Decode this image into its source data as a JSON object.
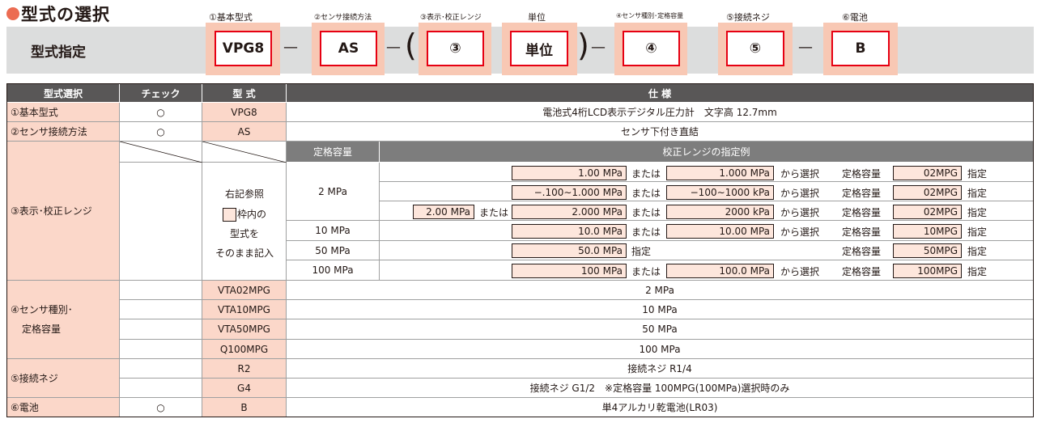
{
  "header": {
    "title": "型式の選択",
    "band_label": "型式指定",
    "slots": [
      {
        "label": "①基本型式",
        "value": "VPG8"
      },
      {
        "label": "②センサ接続方法",
        "value": "AS"
      },
      {
        "label": "③表示･校正レンジ",
        "value": "③"
      },
      {
        "label": "単位",
        "value": "単位"
      },
      {
        "label": "④センサ種別･定格容量",
        "value": "④"
      },
      {
        "label": "⑤接続ネジ",
        "value": "⑤"
      },
      {
        "label": "⑥電池",
        "value": "B"
      }
    ],
    "dash": "—",
    "open_paren": "(",
    "close_paren": ")"
  },
  "table": {
    "headers": {
      "select": "型式選択",
      "check": "チェック",
      "model": "型 式",
      "spec": "仕 様"
    },
    "check_mark": "○",
    "row1": {
      "select": "①基本型式",
      "model": "VPG8",
      "spec": "電池式4桁LCD表示デジタル圧力計　文字高 12.7mm"
    },
    "row2": {
      "select": "②センサ接続方法",
      "model": "AS",
      "spec": "センサ下付き直結"
    },
    "row3": {
      "select": "③表示･校正レンジ",
      "sub_capacity": "定格容量",
      "sub_example": "校正レンジの指定例",
      "note": [
        "右記参照",
        "枠内の",
        "型式を",
        "そのまま記入"
      ],
      "capacities": [
        "2 MPa",
        "10 MPa",
        "50 MPa",
        "100 MPa"
      ],
      "words": {
        "or": "または",
        "choose": "から選択",
        "rated": "定格容量",
        "specify": "指定"
      },
      "lines": [
        {
          "a": "1.00 MPa",
          "b": "1.000 MPa",
          "cap": "02MPG"
        },
        {
          "a": "−.100∼1.000 MPa",
          "b": "−100∼1000 kPa",
          "cap": "02MPG"
        },
        {
          "pre": "2.00 MPa",
          "a": "2.000 MPa",
          "b": "2000 kPa",
          "cap": "02MPG"
        },
        {
          "a": "10.0 MPa",
          "b": "10.00 MPa",
          "cap": "10MPG"
        },
        {
          "a": "50.0 MPa",
          "cap": "50MPG"
        },
        {
          "a": "100 MPa",
          "b": "100.0 MPa",
          "cap": "100MPG"
        }
      ]
    },
    "row4": {
      "select_line1": "④センサ種別･",
      "select_line2": "定格容量",
      "items": [
        {
          "model": "VTA02MPG",
          "spec": "2 MPa"
        },
        {
          "model": "VTA10MPG",
          "spec": "10 MPa"
        },
        {
          "model": "VTA50MPG",
          "spec": "50 MPa"
        },
        {
          "model": "Q100MPG",
          "spec": "100 MPa"
        }
      ]
    },
    "row5": {
      "select": "⑤接続ネジ",
      "items": [
        {
          "model": "R2",
          "spec": "接続ネジ R1/4"
        },
        {
          "model": "G4",
          "spec": "接続ネジ G1/2　※定格容量 100MPG(100MPa)選択時のみ"
        }
      ]
    },
    "row6": {
      "select": "⑥電池",
      "model": "B",
      "spec": "単4アルカリ乾電池(LR03)"
    }
  }
}
